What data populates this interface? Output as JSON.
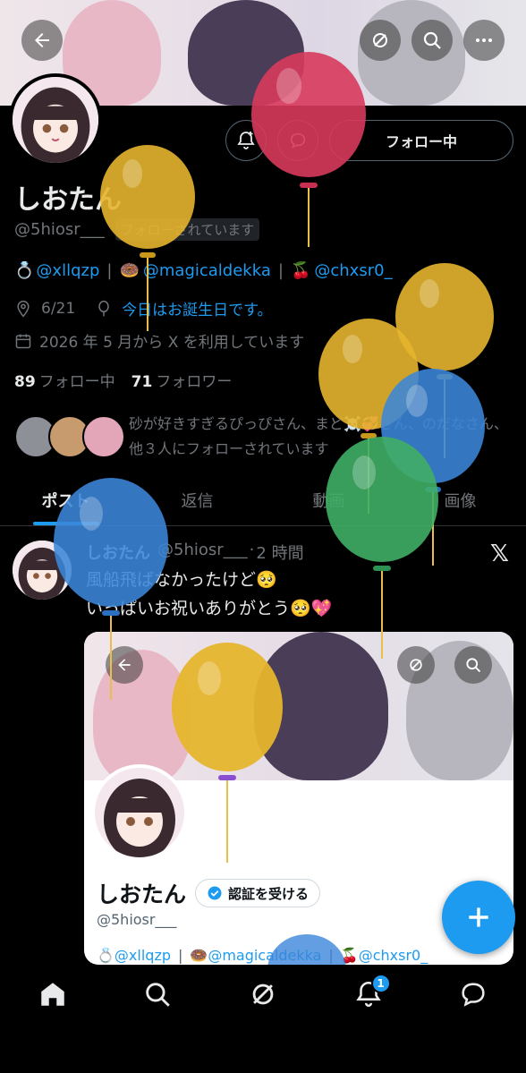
{
  "header": {
    "back_icon": "arrow-left-icon",
    "grok_icon": "grok-icon",
    "search_icon": "search-icon",
    "more_icon": "more-icon"
  },
  "profile": {
    "name": "しおたん",
    "handle": "@5hiosr___",
    "follows_you": "フォローされています",
    "follow_button": "フォロー中",
    "bio": {
      "ring_emoji": "💍",
      "link1": "@xllqzp",
      "sep1": "|",
      "donut_emoji": "🍩",
      "link2": "@magicaldekka",
      "sep2": "|",
      "cherry_emoji": "🍒",
      "link3": "@chxsr0_"
    },
    "location": "6/21",
    "birthday": "今日はお誕生日です。",
    "joined": "2026 年 5 月から X を利用しています",
    "following_count": "89",
    "following_label": "フォロー中",
    "followers_count": "71",
    "followers_label": "フォロワー",
    "followed_by": "砂が好きすぎるぴっぴさん、まど☠️💞さん、のだなさん、他３人にフォローされています"
  },
  "tabs": [
    {
      "label": "ポスト"
    },
    {
      "label": "返信"
    },
    {
      "label": "動画"
    },
    {
      "label": "画像"
    }
  ],
  "tweet": {
    "name": "しおたん",
    "handle": "@5hiosr___",
    "dot": "·",
    "time": "2 時間",
    "line1": "風船飛ばなかったけど🥺",
    "line2": "いっぱいお祝いありがとう🥺💖",
    "embed": {
      "name": "しおたん",
      "verify_label": "認証を受ける",
      "handle": "@5hiosr___",
      "link1": "💍@xllqzp",
      "sep1": "|",
      "link2": "🍩@magicaldekka",
      "sep2": "|",
      "link3": "🍒@chxsr0_"
    }
  },
  "nav": {
    "notifications_badge": "1"
  },
  "colors": {
    "accent": "#1d9bf0",
    "balloon_yellow": "#e6b52d",
    "balloon_red": "#d83a5c",
    "balloon_blue": "#3b86d9",
    "balloon_green": "#3fae66"
  }
}
